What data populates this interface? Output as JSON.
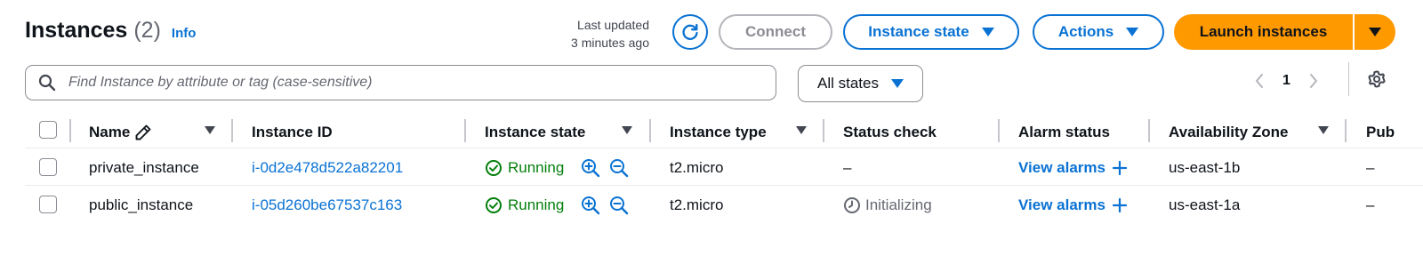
{
  "header": {
    "title": "Instances",
    "count": "(2)",
    "info_label": "Info",
    "last_updated_line1": "Last updated",
    "last_updated_line2": "3 minutes ago",
    "refresh_icon": "refresh-icon",
    "connect_label": "Connect",
    "instance_state_label": "Instance state",
    "actions_label": "Actions",
    "launch_label": "Launch instances"
  },
  "filter": {
    "search_placeholder": "Find Instance by attribute or tag (case-sensitive)",
    "search_value": "",
    "states_label": "All states"
  },
  "pagination": {
    "current_page": "1"
  },
  "table": {
    "columns": [
      "Name",
      "Instance ID",
      "Instance state",
      "Instance type",
      "Status check",
      "Alarm status",
      "Availability Zone",
      "Pub"
    ],
    "rows": [
      {
        "name": "private_instance",
        "instance_id": "i-0d2e478d522a82201",
        "state": "Running",
        "type": "t2.micro",
        "status_check": "–",
        "alarm": "View alarms",
        "az": "us-east-1b",
        "public": "–"
      },
      {
        "name": "public_instance",
        "instance_id": "i-05d260be67537c163",
        "state": "Running",
        "type": "t2.micro",
        "status_check": "Initializing",
        "alarm": "View alarms",
        "az": "us-east-1a",
        "public": "–"
      }
    ]
  },
  "colors": {
    "link": "#0972d3",
    "launch": "#ff9900",
    "running": "#037f0c",
    "muted": "#656871"
  }
}
